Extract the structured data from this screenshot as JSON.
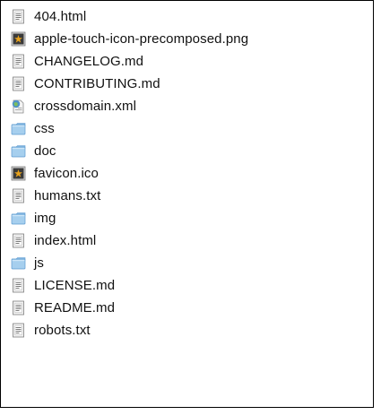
{
  "files": [
    {
      "name": "404.html",
      "icon": "text-document-icon",
      "kind": "doc"
    },
    {
      "name": "apple-touch-icon-precomposed.png",
      "icon": "image-file-icon",
      "kind": "image"
    },
    {
      "name": "CHANGELOG.md",
      "icon": "text-document-icon",
      "kind": "doc"
    },
    {
      "name": "CONTRIBUTING.md",
      "icon": "text-document-icon",
      "kind": "doc"
    },
    {
      "name": "crossdomain.xml",
      "icon": "xml-file-icon",
      "kind": "xml"
    },
    {
      "name": "css",
      "icon": "folder-icon",
      "kind": "folder"
    },
    {
      "name": "doc",
      "icon": "folder-icon",
      "kind": "folder"
    },
    {
      "name": "favicon.ico",
      "icon": "image-file-icon",
      "kind": "image"
    },
    {
      "name": "humans.txt",
      "icon": "text-document-icon",
      "kind": "doc"
    },
    {
      "name": "img",
      "icon": "folder-icon",
      "kind": "folder"
    },
    {
      "name": "index.html",
      "icon": "text-document-icon",
      "kind": "doc"
    },
    {
      "name": "js",
      "icon": "folder-icon",
      "kind": "folder"
    },
    {
      "name": "LICENSE.md",
      "icon": "text-document-icon",
      "kind": "doc"
    },
    {
      "name": "README.md",
      "icon": "text-document-icon",
      "kind": "doc"
    },
    {
      "name": "robots.txt",
      "icon": "text-document-icon",
      "kind": "doc"
    }
  ],
  "colors": {
    "folder_body": "#a6cfee",
    "folder_tab": "#8ebfe6",
    "folder_edge": "#5d9ad0",
    "image_file_bg": "#3a3a3a",
    "image_file_accent": "#e8a21c"
  }
}
